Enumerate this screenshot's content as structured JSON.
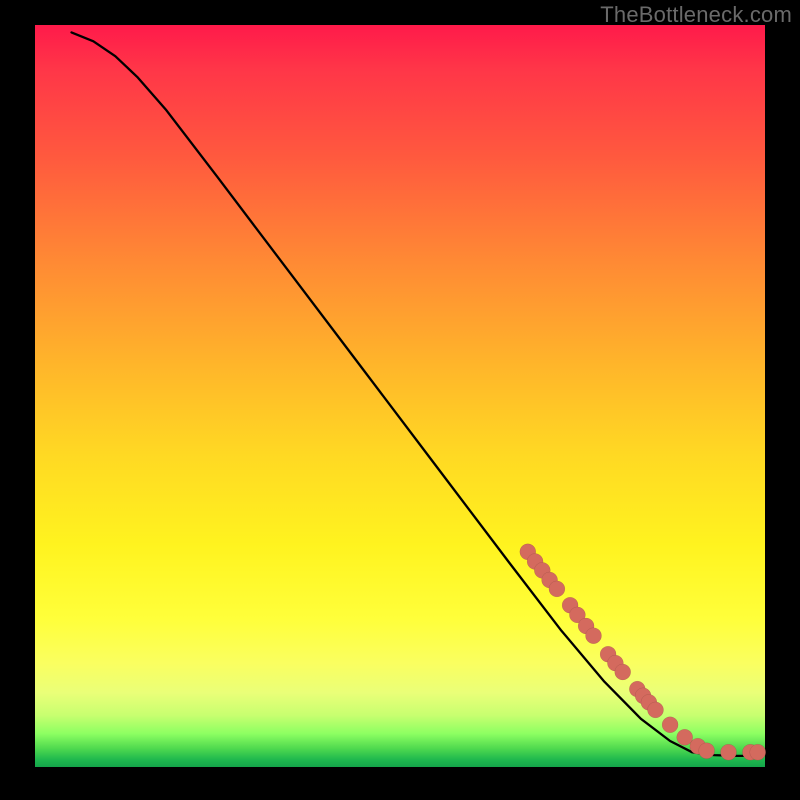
{
  "attribution": "TheBottleneck.com",
  "colors": {
    "marker": "#d46a5e",
    "curve": "#000000",
    "background": "#000000"
  },
  "chart_data": {
    "type": "line",
    "title": "",
    "xlabel": "",
    "ylabel": "",
    "xlim": [
      0,
      100
    ],
    "ylim": [
      0,
      100
    ],
    "grid": false,
    "legend": false,
    "curve": [
      {
        "x": 5.0,
        "y": 99.0
      },
      {
        "x": 8.0,
        "y": 97.8
      },
      {
        "x": 11.0,
        "y": 95.8
      },
      {
        "x": 14.0,
        "y": 93.0
      },
      {
        "x": 18.0,
        "y": 88.5
      },
      {
        "x": 25.0,
        "y": 79.5
      },
      {
        "x": 35.0,
        "y": 66.5
      },
      {
        "x": 45.0,
        "y": 53.5
      },
      {
        "x": 55.0,
        "y": 40.5
      },
      {
        "x": 65.0,
        "y": 27.5
      },
      {
        "x": 72.0,
        "y": 18.5
      },
      {
        "x": 78.0,
        "y": 11.5
      },
      {
        "x": 83.0,
        "y": 6.5
      },
      {
        "x": 87.0,
        "y": 3.5
      },
      {
        "x": 90.0,
        "y": 2.0
      },
      {
        "x": 93.0,
        "y": 1.6
      },
      {
        "x": 96.0,
        "y": 1.5
      },
      {
        "x": 99.0,
        "y": 1.5
      }
    ],
    "markers": [
      {
        "x": 67.5,
        "y": 29.0
      },
      {
        "x": 68.5,
        "y": 27.7
      },
      {
        "x": 69.5,
        "y": 26.5
      },
      {
        "x": 70.5,
        "y": 25.2
      },
      {
        "x": 71.5,
        "y": 24.0
      },
      {
        "x": 73.3,
        "y": 21.8
      },
      {
        "x": 74.3,
        "y": 20.5
      },
      {
        "x": 75.5,
        "y": 19.0
      },
      {
        "x": 76.5,
        "y": 17.7
      },
      {
        "x": 78.5,
        "y": 15.2
      },
      {
        "x": 79.5,
        "y": 14.0
      },
      {
        "x": 80.5,
        "y": 12.8
      },
      {
        "x": 82.5,
        "y": 10.5
      },
      {
        "x": 83.3,
        "y": 9.6
      },
      {
        "x": 84.1,
        "y": 8.7
      },
      {
        "x": 85.0,
        "y": 7.7
      },
      {
        "x": 87.0,
        "y": 5.7
      },
      {
        "x": 89.0,
        "y": 4.0
      },
      {
        "x": 90.8,
        "y": 2.8
      },
      {
        "x": 92.0,
        "y": 2.2
      },
      {
        "x": 95.0,
        "y": 2.0
      },
      {
        "x": 98.0,
        "y": 2.0
      },
      {
        "x": 99.0,
        "y": 2.0
      }
    ],
    "marker_radius_px": 8
  }
}
